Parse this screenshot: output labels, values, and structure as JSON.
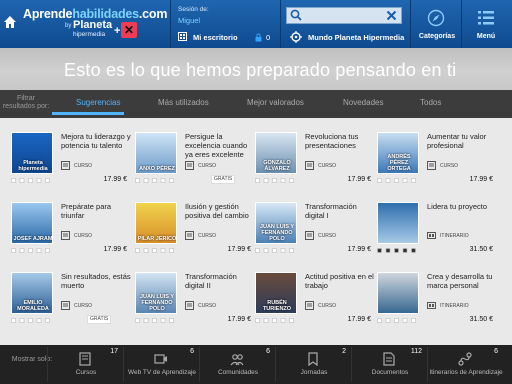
{
  "header": {
    "logo_text_prefix": "Aprende",
    "logo_text_highlight": "habilidades",
    "logo_text_suffix": ".com",
    "logo_by": "by",
    "logo_planeta": "Planeta",
    "logo_hipermedia": "hipermedia",
    "logo_plus": "+",
    "session_label": "Sesión de:",
    "session_user": "Miguel",
    "desk_label": "Mi escritorio",
    "lock_count": "0",
    "search_placeholder": "",
    "world_label": "Mundo Planeta Hipermedia",
    "categories_label": "Categorías",
    "menu_label": "Menú"
  },
  "banner": {
    "title": "Esto es lo que hemos preparado pensando en ti"
  },
  "filters": {
    "label": "Filtrar resultados por:",
    "tabs": [
      "Sugerencias",
      "Más utilizados",
      "Mejor valorados",
      "Novedades",
      "Todos"
    ],
    "active": "Sugerencias"
  },
  "cards": [
    {
      "title": "Mejora tu liderazgo y potencia tu talento",
      "type": "CURSO",
      "price": "17.99 €",
      "thumb_label": "Planeta hipermedia",
      "rating": 0,
      "free_label": ""
    },
    {
      "title": "Persigue la excelencia cuando ya eres excelente",
      "type": "CURSO",
      "price": "",
      "thumb_label": "ANXO PÉREZ",
      "rating": 0,
      "free_label": "GRATIS"
    },
    {
      "title": "Revoluciona tus presentaciones",
      "type": "CURSO",
      "price": "17.99 €",
      "thumb_label": "GONZALO ÁLVAREZ",
      "rating": 0,
      "free_label": ""
    },
    {
      "title": "Aumentar tu valor profesional",
      "type": "CURSO",
      "price": "17.99 €",
      "thumb_label": "ANDRÉS PÉREZ ORTEGA",
      "rating": 0,
      "free_label": ""
    },
    {
      "title": "Prepárate para triunfar",
      "type": "CURSO",
      "price": "17.99 €",
      "thumb_label": "JOSEF AJRAM",
      "rating": 0,
      "free_label": ""
    },
    {
      "title": "Ilusión y gestión positiva del cambio",
      "type": "CURSO",
      "price": "17.99 €",
      "thumb_label": "PILAR JERICÓ",
      "rating": 0,
      "free_label": ""
    },
    {
      "title": "Transformación digital I",
      "type": "CURSO",
      "price": "17.99 €",
      "thumb_label": "JUAN LUIS Y FERNANDO POLO",
      "rating": 0,
      "free_label": ""
    },
    {
      "title": "Lidera tu proyecto",
      "type": "ITINERARIO",
      "price": "31.50 €",
      "thumb_label": "",
      "rating": 5,
      "free_label": ""
    },
    {
      "title": "Sin resultados, estás muerto",
      "type": "CURSO",
      "price": "",
      "thumb_label": "EMILIO MORALEDA",
      "rating": 0,
      "free_label": "GRATIS"
    },
    {
      "title": "Transformación digital II",
      "type": "CURSO",
      "price": "17.99 €",
      "thumb_label": "JUAN LUIS Y FERNANDO POLO",
      "rating": 0,
      "free_label": ""
    },
    {
      "title": "Actitud positiva en el trabajo",
      "type": "CURSO",
      "price": "17.99 €",
      "thumb_label": "RUBÉN TURIENZO",
      "rating": 0,
      "free_label": ""
    },
    {
      "title": "Crea y desarrolla tu marca personal",
      "type": "ITINERARIO",
      "price": "31.50 €",
      "thumb_label": "",
      "rating": 0,
      "free_label": ""
    }
  ],
  "bottom": {
    "label": "Mostrar solo:",
    "tabs": [
      {
        "label": "Cursos",
        "count": "17",
        "icon": "book-icon"
      },
      {
        "label": "Web TV de Aprendizaje",
        "count": "6",
        "icon": "video-icon"
      },
      {
        "label": "Comunidades",
        "count": "6",
        "icon": "people-icon"
      },
      {
        "label": "Jornadas",
        "count": "2",
        "icon": "bookmark-icon"
      },
      {
        "label": "Documentos",
        "count": "112",
        "icon": "document-icon"
      },
      {
        "label": "Itinerarios de Aprendizaje",
        "count": "6",
        "icon": "route-icon"
      }
    ]
  },
  "colors": {
    "topbar": "#1a5da8",
    "accent": "#4fb3ff",
    "banner": "#c6c6c6",
    "filterbar": "#3c3c3c",
    "bottombar": "#222222"
  }
}
